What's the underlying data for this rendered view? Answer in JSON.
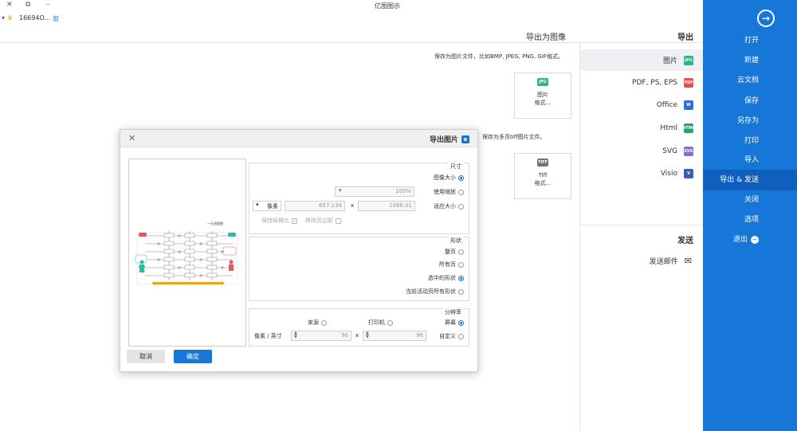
{
  "window": {
    "title": "亿图图示",
    "controls": {
      "close": "✕",
      "restore": "⧉",
      "minimize": "–"
    }
  },
  "toolbar": {
    "user": "16694О...",
    "window_icon": "窗"
  },
  "sidebar": {
    "items": [
      {
        "label": "打开"
      },
      {
        "label": "新建"
      },
      {
        "label": "云文档"
      },
      {
        "label": "保存"
      },
      {
        "label": "另存为"
      },
      {
        "label": "打印"
      },
      {
        "label": "导入"
      },
      {
        "label": "导出 & 发送"
      },
      {
        "label": "关闭"
      },
      {
        "label": "选项"
      },
      {
        "label": "退出"
      }
    ],
    "active_index": 7,
    "color": "#1677d9"
  },
  "export_menu": {
    "title": "导出",
    "items": [
      {
        "label": "图片",
        "icon": "JPG",
        "color": "#2bb38a"
      },
      {
        "label": "PDF, PS, EPS",
        "icon": "PDF",
        "color": "#e8504f"
      },
      {
        "label": "Office",
        "icon": "W",
        "color": "#2b71d9"
      },
      {
        "label": "Html",
        "icon": "HTML",
        "color": "#2ba06e"
      },
      {
        "label": "SVG",
        "icon": "SVG",
        "color": "#8a6bd1"
      },
      {
        "label": "Visio",
        "icon": "V",
        "color": "#3a5db8"
      }
    ],
    "send_title": "发送",
    "send_item": "发送邮件"
  },
  "main": {
    "heading": "导出为图像",
    "desc_image": "保存为图片文件，比如BMP, JPEG, PNG, GIF格式。",
    "desc_tiff": "保存为多页tiff图片文件。",
    "card_image": {
      "icon": "JPG",
      "line1": "图片",
      "line2": "格式..."
    },
    "card_tiff": {
      "icon": "TIFF",
      "line1": "Tiff",
      "line2": "格式..."
    }
  },
  "dialog": {
    "title": "导出图片",
    "app_icon": "e",
    "size_group": {
      "title": "尺寸",
      "option_original": "图像大小",
      "option_scale": "使用缩放",
      "scale_value": "100%",
      "option_fit": "适应大小",
      "width_value": "1066.01",
      "height_value": "657.134",
      "unit": "像素",
      "remove_margin": "移除页边距",
      "keep_ratio": "保持纵横比"
    },
    "shape_group": {
      "title": "形状",
      "option_page": "整页",
      "option_all": "所有页",
      "option_selected": "选中的形状",
      "option_current": "当前活动页所有形状"
    },
    "resolution_group": {
      "title": "分辨率",
      "option_screen": "屏幕",
      "option_printer": "打印机",
      "option_source": "来源",
      "option_custom": "自定义",
      "dpi_x": "96",
      "dpi_y": "96",
      "dpi_unit": "像素 / 英寸"
    },
    "ok_label": "确定",
    "cancel_label": "取消",
    "preview_title": "一元流程图"
  }
}
